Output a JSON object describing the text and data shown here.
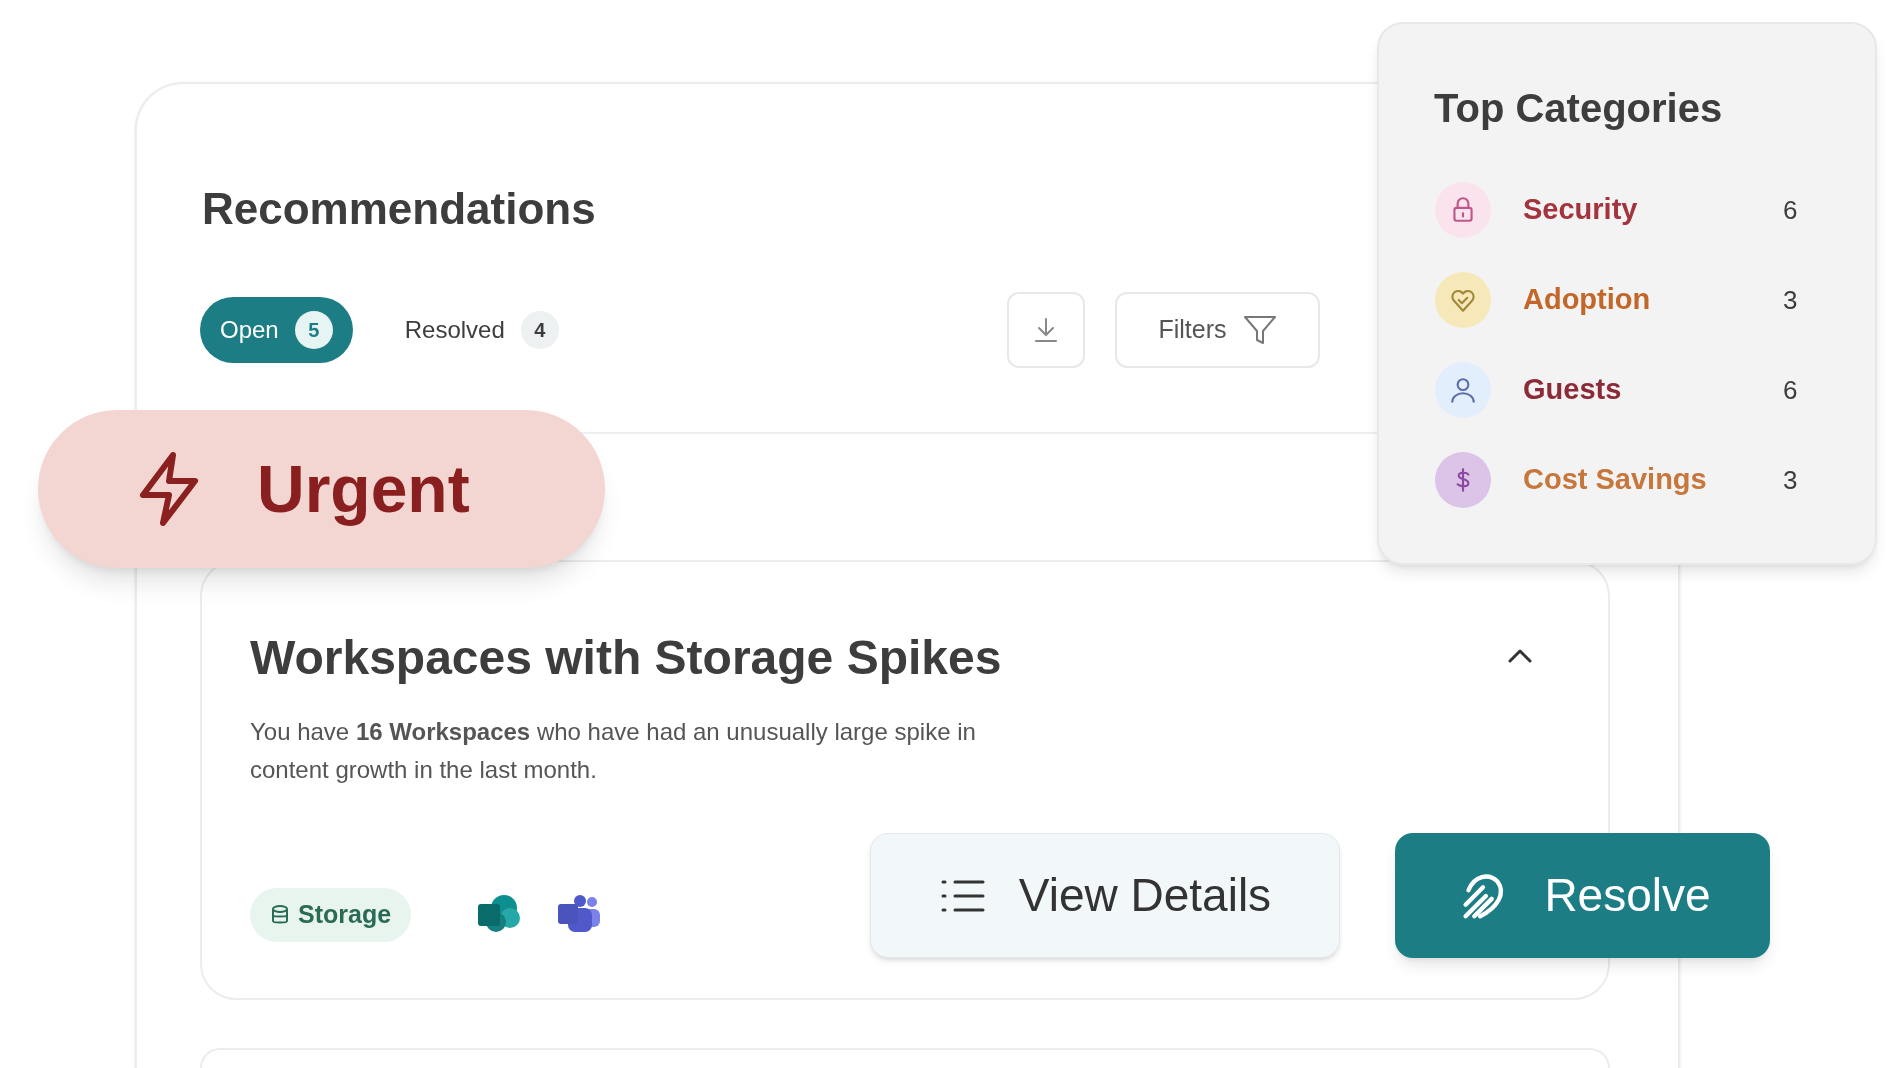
{
  "recommendations": {
    "title": "Recommendations",
    "tabs": [
      {
        "label": "Open",
        "count": "5",
        "selected": true
      },
      {
        "label": "Resolved",
        "count": "4",
        "selected": false
      }
    ],
    "filters_button": "Filters"
  },
  "urgent_badge": "Urgent",
  "recommendation_card": {
    "title": "Workspaces with Storage Spikes",
    "description": "You have **16 Workspaces** who have had an unusually large spike in content growth in the last month.",
    "expanded": true,
    "tag": "Storage",
    "actions": [
      {
        "label": "View Details",
        "kind": "secondary"
      },
      {
        "label": "Resolve",
        "kind": "primary"
      }
    ]
  },
  "top_categories": {
    "title": "Top Categories",
    "items": [
      {
        "label": "Security",
        "count": "6",
        "kind": "lock",
        "color": "#a3343e"
      },
      {
        "label": "Adoption",
        "count": "3",
        "kind": "heart",
        "color": "#c2662a"
      },
      {
        "label": "Guests",
        "count": "6",
        "kind": "person",
        "color": "#8c2b38"
      },
      {
        "label": "Cost Savings",
        "count": "3",
        "kind": "dollar",
        "color": "#c7763c"
      }
    ]
  }
}
